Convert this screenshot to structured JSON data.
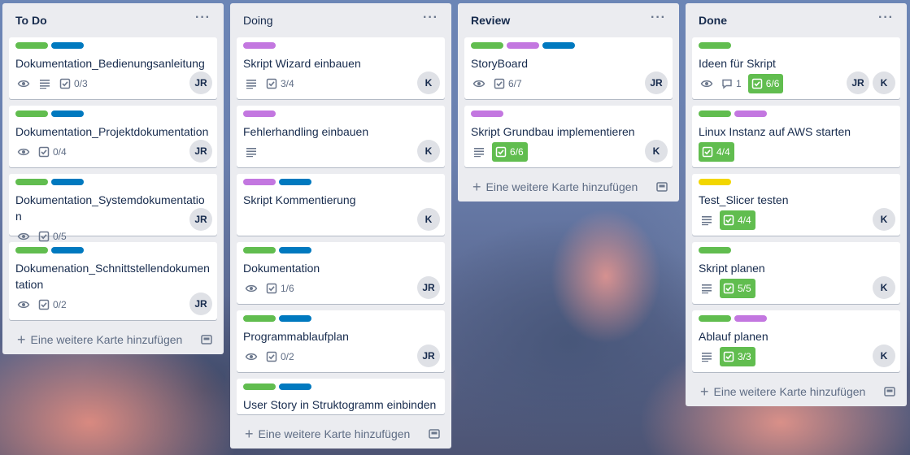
{
  "colors": {
    "green": "#61bd4f",
    "blue": "#0079bf",
    "purple": "#c377e0",
    "yellow": "#f2d600"
  },
  "lists": [
    {
      "title": "To Do",
      "cards": [
        {
          "labels": [
            "green",
            "blue"
          ],
          "title": "Dokumentation_Bedienungsanleitung",
          "watch": true,
          "description": true,
          "checklist": "0/3",
          "members": [
            "JR"
          ]
        },
        {
          "labels": [
            "green",
            "blue"
          ],
          "title": "Dokumentation_Projektdokumentation",
          "watch": true,
          "checklist": "0/4",
          "members": [
            "JR"
          ]
        },
        {
          "labels": [
            "green",
            "blue"
          ],
          "title": "Dokumentation_Systemdokumentation",
          "watch": true,
          "checklist": "0/5",
          "members": [
            "JR"
          ]
        },
        {
          "labels": [
            "green",
            "blue"
          ],
          "title": "Dokumenation_Schnittstellendokumentation",
          "watch": true,
          "checklist": "0/2",
          "members": [
            "JR"
          ]
        }
      ],
      "add_label": "Eine weitere Karte hinzufügen"
    },
    {
      "title": "Doing",
      "cards": [
        {
          "labels": [
            "purple"
          ],
          "title": "Skript Wizard einbauen",
          "description": true,
          "checklist": "3/4",
          "members": [
            "K"
          ]
        },
        {
          "labels": [
            "purple"
          ],
          "title": "Fehlerhandling einbauen",
          "description": true,
          "members": [
            "K"
          ]
        },
        {
          "labels": [
            "purple",
            "blue"
          ],
          "title": "Skript Kommentierung",
          "members": [
            "K"
          ]
        },
        {
          "labels": [
            "green",
            "blue"
          ],
          "title": "Dokumentation",
          "watch": true,
          "checklist": "1/6",
          "members": [
            "JR"
          ]
        },
        {
          "labels": [
            "green",
            "blue"
          ],
          "title": "Programmablaufplan",
          "watch": true,
          "checklist": "0/2",
          "members": [
            "JR"
          ]
        },
        {
          "labels": [
            "green",
            "blue"
          ],
          "title": "User Story in Struktogramm einbinden",
          "members": []
        }
      ],
      "add_label": "Eine weitere Karte hinzufügen"
    },
    {
      "title": "Review",
      "cards": [
        {
          "labels": [
            "green",
            "purple",
            "blue"
          ],
          "title": "StoryBoard",
          "watch": true,
          "checklist": "6/7",
          "members": [
            "JR"
          ]
        },
        {
          "labels": [
            "purple"
          ],
          "title": "Skript Grundbau implementieren",
          "description": true,
          "checklist": "6/6",
          "checklist_done": true,
          "members": [
            "K"
          ]
        }
      ],
      "add_label": "Eine weitere Karte hinzufügen"
    },
    {
      "title": "Done",
      "cards": [
        {
          "labels": [
            "green"
          ],
          "title": "Ideen für Skript",
          "watch": true,
          "comments": "1",
          "checklist": "6/6",
          "checklist_done": true,
          "members": [
            "JR",
            "K"
          ]
        },
        {
          "labels": [
            "green",
            "purple"
          ],
          "title": "Linux Instanz auf AWS starten",
          "checklist": "4/4",
          "checklist_done": true,
          "members": []
        },
        {
          "labels": [
            "yellow"
          ],
          "title": "Test_Slicer testen",
          "description": true,
          "checklist": "4/4",
          "checklist_done": true,
          "members": [
            "K"
          ]
        },
        {
          "labels": [
            "green"
          ],
          "title": "Skript planen",
          "description": true,
          "checklist": "5/5",
          "checklist_done": true,
          "members": [
            "K"
          ]
        },
        {
          "labels": [
            "green",
            "purple"
          ],
          "title": "Ablauf planen",
          "description": true,
          "checklist": "3/3",
          "checklist_done": true,
          "members": [
            "K"
          ]
        }
      ],
      "add_label": "Eine weitere Karte hinzufügen"
    }
  ],
  "icons": {
    "menu": "more-icon",
    "watch": "eye-icon",
    "description": "description-icon",
    "checklist": "checklist-icon",
    "comments": "comment-icon",
    "add": "plus-icon",
    "template": "card-template-icon"
  }
}
